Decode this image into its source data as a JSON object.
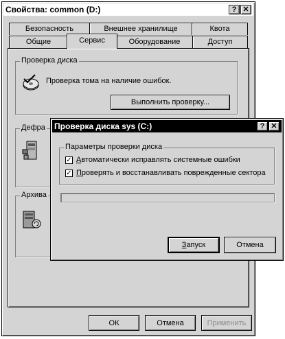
{
  "main_window": {
    "title": "Свойства: common (D:)",
    "help_glyph": "?",
    "close_glyph": "✕",
    "tabs_row1": [
      "Безопасность",
      "Внешнее хранилище",
      "Квота"
    ],
    "tabs_row2": [
      "Общие",
      "Сервис",
      "Оборудование",
      "Доступ"
    ],
    "selected_tab": "Сервис",
    "groups": {
      "check": {
        "label": "Проверка диска",
        "description": "Проверка тома на наличие ошибок.",
        "button": "Выполнить проверку..."
      },
      "defrag": {
        "label": "Дефра"
      },
      "archive": {
        "label": "Архива"
      }
    },
    "buttons": {
      "ok": "ОК",
      "cancel": "Отмена",
      "apply": "Применить"
    }
  },
  "dialog": {
    "title": "Проверка диска sys (C:)",
    "help_glyph": "?",
    "close_glyph": "✕",
    "group_label": "Параметры проверки диска",
    "option1": {
      "label_accel": "А",
      "label_rest": "втоматически исправлять системные ошибки",
      "checked": true
    },
    "option2": {
      "label_accel": "П",
      "label_rest": "роверять и восстанавливать поврежденные сектора",
      "checked": true
    },
    "progress": 0,
    "start_accel": "З",
    "start_rest": "апуск",
    "cancel": "Отмена"
  },
  "check_glyph": "✓",
  "icons": [
    "check-disk-icon",
    "defrag-icon",
    "backup-icon"
  ]
}
